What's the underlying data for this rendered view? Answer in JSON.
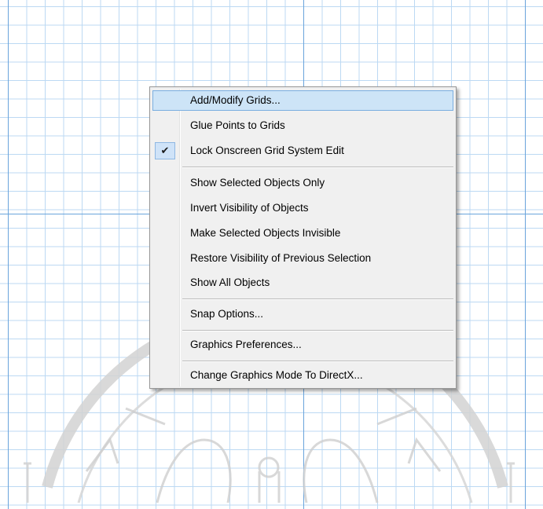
{
  "menu": {
    "items": [
      {
        "label": "Add/Modify Grids...",
        "highlighted": true
      },
      {
        "label": "Glue Points to Grids"
      },
      {
        "label": "Lock Onscreen Grid System Edit",
        "checked": true,
        "check_glyph": "✔"
      },
      {
        "label": "Show Selected Objects Only"
      },
      {
        "label": "Invert Visibility of Objects"
      },
      {
        "label": "Make Selected Objects Invisible"
      },
      {
        "label": "Restore Visibility of Previous Selection"
      },
      {
        "label": "Show All Objects"
      },
      {
        "label": "Snap Options..."
      },
      {
        "label": "Graphics Preferences..."
      },
      {
        "label": "Change Graphics Mode To DirectX..."
      }
    ]
  },
  "colors": {
    "grid_minor": "#bcd9f3",
    "grid_major": "#6aa4dc",
    "menu_bg": "#f0f0f0",
    "highlight_bg": "#cde4f7",
    "highlight_border": "#7aaee0"
  }
}
